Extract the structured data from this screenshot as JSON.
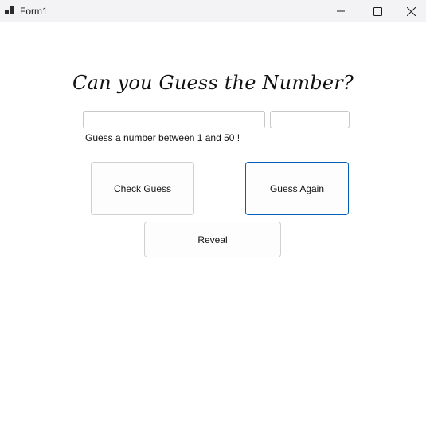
{
  "window": {
    "title": "Form1",
    "icon": "windows-forms-app-icon",
    "controls": {
      "minimize_icon": "minimize-icon",
      "maximize_icon": "maximize-icon",
      "close_icon": "close-icon"
    }
  },
  "main": {
    "heading": "Can you Guess the Number?",
    "guess_input": {
      "value": "",
      "placeholder": ""
    },
    "secret_input": {
      "value": "",
      "placeholder": ""
    },
    "hint": "Guess a number between 1 and 50 !",
    "buttons": {
      "check": "Check Guess",
      "again": "Guess Again",
      "reveal": "Reveal"
    }
  },
  "colors": {
    "titlebar": "#f3f3f5",
    "focus_border": "#005fb8",
    "background": "#ffffff"
  }
}
